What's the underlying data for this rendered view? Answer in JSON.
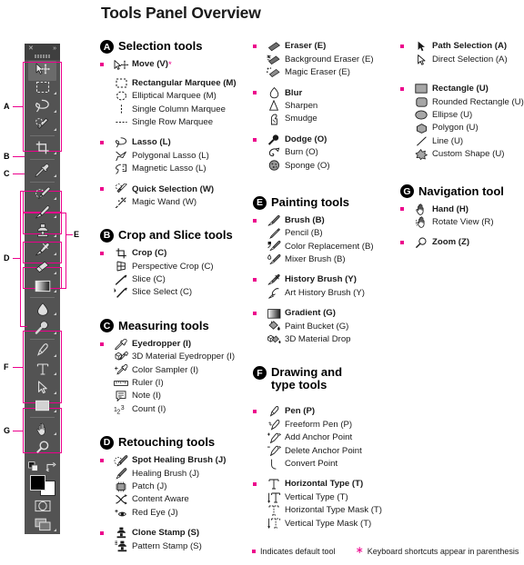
{
  "page_title": "Tools Panel Overview",
  "colors": {
    "accent": "#ec008c",
    "panel_bg": "#535353",
    "panel_header": "#3f3f3f",
    "text": "#1a1a1a"
  },
  "toolbar_panel": {
    "close_glyph": "✕",
    "collapse_glyph": "»",
    "bracket_labels": [
      "A",
      "B",
      "C",
      "D",
      "E",
      "F",
      "G"
    ],
    "slots": [
      {
        "icon": "move-icon",
        "selected": true,
        "has_flyout": false
      },
      {
        "icon": "rectangular-marquee-icon",
        "selected": false,
        "has_flyout": true
      },
      {
        "icon": "lasso-icon",
        "selected": false,
        "has_flyout": true
      },
      {
        "icon": "quick-selection-icon",
        "selected": false,
        "has_flyout": true
      },
      {
        "icon": "crop-icon",
        "selected": false,
        "has_flyout": true
      },
      {
        "icon": "eyedropper-icon",
        "selected": false,
        "has_flyout": true
      },
      {
        "icon": "spot-healing-brush-icon",
        "selected": false,
        "has_flyout": true
      },
      {
        "icon": "brush-icon",
        "selected": false,
        "has_flyout": true
      },
      {
        "icon": "clone-stamp-icon",
        "selected": false,
        "has_flyout": true
      },
      {
        "icon": "history-brush-icon",
        "selected": false,
        "has_flyout": true
      },
      {
        "icon": "eraser-icon",
        "selected": false,
        "has_flyout": true
      },
      {
        "icon": "gradient-icon",
        "selected": false,
        "has_flyout": true
      },
      {
        "icon": "blur-icon",
        "selected": false,
        "has_flyout": true
      },
      {
        "icon": "dodge-icon",
        "selected": false,
        "has_flyout": true
      },
      {
        "icon": "pen-icon",
        "selected": false,
        "has_flyout": true
      },
      {
        "icon": "horizontal-type-icon",
        "selected": false,
        "has_flyout": true
      },
      {
        "icon": "path-selection-icon",
        "selected": false,
        "has_flyout": true
      },
      {
        "icon": "rectangle-shape-icon",
        "selected": false,
        "has_flyout": true
      },
      {
        "icon": "hand-icon",
        "selected": false,
        "has_flyout": true
      },
      {
        "icon": "zoom-icon",
        "selected": false,
        "has_flyout": false
      }
    ],
    "bottom_controls": [
      {
        "icon": "default-colors-icon"
      },
      {
        "icon": "swap-colors-icon"
      },
      {
        "icon": "foreground-background-swatch"
      },
      {
        "icon": "quick-mask-icon"
      },
      {
        "icon": "screen-mode-icon"
      }
    ]
  },
  "columns": [
    {
      "groups": [
        {
          "letter": "A",
          "title": "Selection tools",
          "subgroups": [
            {
              "tools": [
                {
                  "label": "Move (V)",
                  "icon": "move-icon",
                  "default": true,
                  "star": true
                },
                {
                  "label": "Rectangular Marquee (M)",
                  "icon": "rectangular-marquee-icon",
                  "default": false,
                  "indent": true
                },
                {
                  "label": "Elliptical Marquee (M)",
                  "icon": "elliptical-marquee-icon",
                  "default": false
                },
                {
                  "label": "Single Column Marquee",
                  "icon": "single-column-marquee-icon",
                  "default": false
                },
                {
                  "label": "Single Row Marquee",
                  "icon": "single-row-marquee-icon",
                  "default": false
                }
              ]
            },
            {
              "tools": [
                {
                  "label": "Lasso (L)",
                  "icon": "lasso-icon",
                  "default": true
                },
                {
                  "label": "Polygonal Lasso (L)",
                  "icon": "polygonal-lasso-icon",
                  "default": false
                },
                {
                  "label": "Magnetic Lasso (L)",
                  "icon": "magnetic-lasso-icon",
                  "default": false
                }
              ]
            },
            {
              "tools": [
                {
                  "label": "Quick Selection (W)",
                  "icon": "quick-selection-icon",
                  "default": true
                },
                {
                  "label": "Magic Wand (W)",
                  "icon": "magic-wand-icon",
                  "default": false
                }
              ]
            }
          ]
        },
        {
          "letter": "B",
          "title": "Crop and Slice tools",
          "subgroups": [
            {
              "tools": [
                {
                  "label": "Crop (C)",
                  "icon": "crop-icon",
                  "default": true
                },
                {
                  "label": "Perspective Crop (C)",
                  "icon": "perspective-crop-icon",
                  "default": false
                },
                {
                  "label": "Slice (C)",
                  "icon": "slice-icon",
                  "default": false
                },
                {
                  "label": "Slice Select (C)",
                  "icon": "slice-select-icon",
                  "default": false
                }
              ]
            }
          ]
        },
        {
          "letter": "C",
          "title": "Measuring tools",
          "subgroups": [
            {
              "tools": [
                {
                  "label": "Eyedropper (I)",
                  "icon": "eyedropper-icon",
                  "default": true
                },
                {
                  "label": "3D Material Eyedropper (I)",
                  "icon": "3d-material-eyedropper-icon",
                  "default": false
                },
                {
                  "label": "Color Sampler (I)",
                  "icon": "color-sampler-icon",
                  "default": false
                },
                {
                  "label": "Ruler (I)",
                  "icon": "ruler-icon",
                  "default": false
                },
                {
                  "label": "Note (I)",
                  "icon": "note-icon",
                  "default": false
                },
                {
                  "label": "Count (I)",
                  "icon": "count-icon",
                  "default": false
                }
              ]
            }
          ]
        },
        {
          "letter": "D",
          "title": "Retouching tools",
          "subgroups": [
            {
              "tools": [
                {
                  "label": "Spot Healing Brush (J)",
                  "icon": "spot-healing-brush-icon",
                  "default": true
                },
                {
                  "label": "Healing Brush (J)",
                  "icon": "healing-brush-icon",
                  "default": false
                },
                {
                  "label": "Patch (J)",
                  "icon": "patch-icon",
                  "default": false
                },
                {
                  "label": "Content Aware",
                  "icon": "content-aware-icon",
                  "default": false
                },
                {
                  "label": "Red Eye (J)",
                  "icon": "red-eye-icon",
                  "default": false
                }
              ]
            },
            {
              "tools": [
                {
                  "label": "Clone Stamp (S)",
                  "icon": "clone-stamp-icon",
                  "default": true
                },
                {
                  "label": "Pattern Stamp (S)",
                  "icon": "pattern-stamp-icon",
                  "default": false
                }
              ]
            }
          ]
        }
      ]
    },
    {
      "groups": [
        {
          "letter": "",
          "title": "",
          "subgroups": [
            {
              "tools": [
                {
                  "label": "Eraser (E)",
                  "icon": "eraser-icon",
                  "default": true
                },
                {
                  "label": "Background Eraser (E)",
                  "icon": "background-eraser-icon",
                  "default": false
                },
                {
                  "label": "Magic Eraser (E)",
                  "icon": "magic-eraser-icon",
                  "default": false
                }
              ]
            },
            {
              "tools": [
                {
                  "label": "Blur",
                  "icon": "blur-icon",
                  "default": true
                },
                {
                  "label": "Sharpen",
                  "icon": "sharpen-icon",
                  "default": false
                },
                {
                  "label": "Smudge",
                  "icon": "smudge-icon",
                  "default": false
                }
              ]
            },
            {
              "tools": [
                {
                  "label": "Dodge (O)",
                  "icon": "dodge-icon",
                  "default": true
                },
                {
                  "label": "Burn (O)",
                  "icon": "burn-icon",
                  "default": false
                },
                {
                  "label": "Sponge (O)",
                  "icon": "sponge-icon",
                  "default": false
                }
              ]
            }
          ]
        },
        {
          "letter": "E",
          "title": "Painting tools",
          "subgroups": [
            {
              "tools": [
                {
                  "label": "Brush (B)",
                  "icon": "brush-icon",
                  "default": true
                },
                {
                  "label": "Pencil (B)",
                  "icon": "pencil-icon",
                  "default": false
                },
                {
                  "label": "Color Replacement (B)",
                  "icon": "color-replacement-icon",
                  "default": false
                },
                {
                  "label": "Mixer Brush (B)",
                  "icon": "mixer-brush-icon",
                  "default": false
                }
              ]
            },
            {
              "tools": [
                {
                  "label": "History Brush (Y)",
                  "icon": "history-brush-icon",
                  "default": true
                },
                {
                  "label": "Art History Brush (Y)",
                  "icon": "art-history-brush-icon",
                  "default": false
                }
              ]
            },
            {
              "tools": [
                {
                  "label": "Gradient (G)",
                  "icon": "gradient-icon",
                  "default": true
                },
                {
                  "label": "Paint Bucket (G)",
                  "icon": "paint-bucket-icon",
                  "default": false
                },
                {
                  "label": "3D Material Drop",
                  "icon": "3d-material-drop-icon",
                  "default": false
                }
              ]
            }
          ]
        },
        {
          "letter": "F",
          "title": "Drawing and type tools",
          "subgroups": [
            {
              "tools": [
                {
                  "label": "Pen (P)",
                  "icon": "pen-icon",
                  "default": true
                },
                {
                  "label": "Freeform Pen (P)",
                  "icon": "freeform-pen-icon",
                  "default": false
                },
                {
                  "label": "Add Anchor Point",
                  "icon": "add-anchor-point-icon",
                  "default": false
                },
                {
                  "label": "Delete Anchor Point",
                  "icon": "delete-anchor-point-icon",
                  "default": false
                },
                {
                  "label": "Convert Point",
                  "icon": "convert-point-icon",
                  "default": false
                }
              ]
            },
            {
              "tools": [
                {
                  "label": "Horizontal Type (T)",
                  "icon": "horizontal-type-icon",
                  "default": true
                },
                {
                  "label": "Vertical Type (T)",
                  "icon": "vertical-type-icon",
                  "default": false
                },
                {
                  "label": "Horizontal Type Mask (T)",
                  "icon": "horizontal-type-mask-icon",
                  "default": false
                },
                {
                  "label": "Vertical Type Mask (T)",
                  "icon": "vertical-type-mask-icon",
                  "default": false
                }
              ]
            }
          ]
        }
      ]
    },
    {
      "groups": [
        {
          "letter": "",
          "title": "",
          "subgroups": [
            {
              "tools": [
                {
                  "label": "Path Selection (A)",
                  "icon": "path-selection-icon",
                  "default": true
                },
                {
                  "label": "Direct Selection (A)",
                  "icon": "direct-selection-icon",
                  "default": false
                }
              ]
            },
            {
              "tools": [
                {
                  "label": "Rectangle (U)",
                  "icon": "rectangle-shape-icon",
                  "default": true
                },
                {
                  "label": "Rounded Rectangle (U)",
                  "icon": "rounded-rectangle-icon",
                  "default": false
                },
                {
                  "label": "Ellipse (U)",
                  "icon": "ellipse-icon",
                  "default": false
                },
                {
                  "label": "Polygon (U)",
                  "icon": "polygon-icon",
                  "default": false
                },
                {
                  "label": "Line (U)",
                  "icon": "line-icon",
                  "default": false
                },
                {
                  "label": "Custom Shape (U)",
                  "icon": "custom-shape-icon",
                  "default": false
                }
              ]
            }
          ]
        },
        {
          "letter": "G",
          "title": "Navigation tool",
          "subgroups": [
            {
              "tools": [
                {
                  "label": "Hand (H)",
                  "icon": "hand-icon",
                  "default": true
                },
                {
                  "label": "Rotate View (R)",
                  "icon": "rotate-view-icon",
                  "default": false
                }
              ]
            },
            {
              "tools": [
                {
                  "label": "Zoom (Z)",
                  "icon": "zoom-icon",
                  "default": true
                }
              ]
            }
          ]
        }
      ]
    }
  ],
  "legend": {
    "default_tool_text": "Indicates default tool",
    "shortcut_star": "∗",
    "shortcut_text": "Keyboard shortcuts appear in parenthesis"
  }
}
